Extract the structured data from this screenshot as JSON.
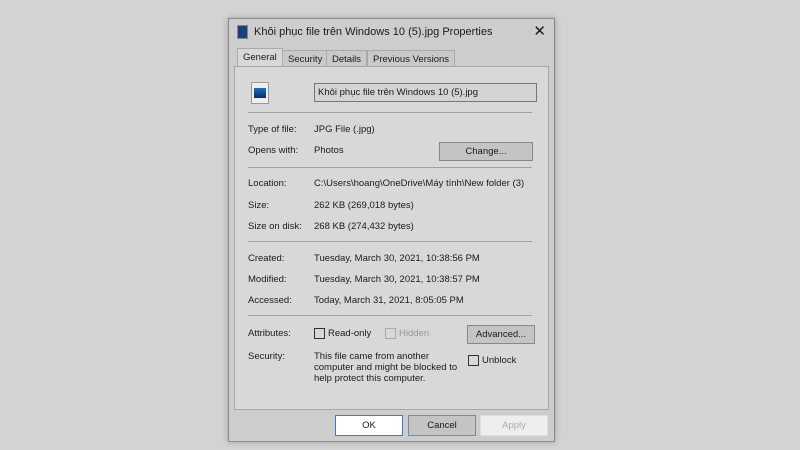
{
  "title": "Khôi phục file trên Windows 10 (5).jpg Properties",
  "tabs": [
    "General",
    "Security",
    "Details",
    "Previous Versions"
  ],
  "filename": "Khôi phục file trên Windows 10 (5).jpg",
  "labels": {
    "type": "Type of file:",
    "opens": "Opens with:",
    "location": "Location:",
    "size": "Size:",
    "size_disk": "Size on disk:",
    "created": "Created:",
    "modified": "Modified:",
    "accessed": "Accessed:",
    "attributes": "Attributes:",
    "security": "Security:"
  },
  "values": {
    "type": "JPG File (.jpg)",
    "opens": "Photos",
    "location": "C:\\Users\\hoang\\OneDrive\\Máy tính\\New folder (3)",
    "size": "262 KB (269,018 bytes)",
    "size_disk": "268 KB (274,432 bytes)",
    "created": "Tuesday, March 30, 2021, 10:38:56 PM",
    "modified": "Tuesday, March 30, 2021, 10:38:57 PM",
    "accessed": "Today, March 31, 2021, 8:05:05 PM",
    "security": "This file came from another computer and might be blocked to help protect this computer."
  },
  "buttons": {
    "change": "Change...",
    "advanced": "Advanced...",
    "ok": "OK",
    "cancel": "Cancel",
    "apply": "Apply"
  },
  "checkboxes": {
    "readonly": "Read-only",
    "hidden": "Hidden",
    "unblock": "Unblock"
  }
}
